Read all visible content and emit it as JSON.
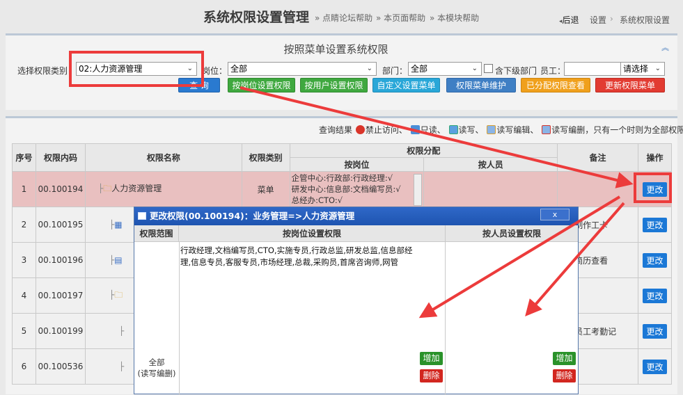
{
  "header": {
    "title": "系统权限设置管理",
    "links": [
      "» 点睛论坛帮助",
      "» 本页面帮助",
      "» 本模块帮助"
    ],
    "breadcrumb": {
      "back": "后退",
      "items": [
        "设置",
        "系统权限设置"
      ]
    }
  },
  "filter": {
    "heading": "按照菜单设置系统权限",
    "category_label": "选择权限类别",
    "category_value": "02:人力资源管理",
    "post_label": "岗位：",
    "post_value": "全部",
    "dept_label": "部门：",
    "dept_value": "全部",
    "subdept_label": "含下级部门",
    "staff_label": "员工：",
    "staff_select": "请选择",
    "buttons": {
      "query": "查 询",
      "by_post": "按岗位设置权限",
      "by_user": "按用户设置权限",
      "custom_menu": "自定义设置菜单",
      "menu_maint": "权限菜单维护",
      "assigned_view": "已分配权限查看",
      "refresh_menu": "更新权限菜单"
    }
  },
  "legend": {
    "query_result": "查询结果",
    "forbid": "禁止访问、",
    "read": "只读、",
    "readwrite": "读写、",
    "readwriteedit": "读写编辑、",
    "readwriteeditdel": "读写编删",
    "note": "，只有一个时则为全部权限"
  },
  "table": {
    "headers": {
      "seq": "序号",
      "code": "权限内码",
      "name": "权限名称",
      "type": "权限类别",
      "assign": "权限分配",
      "by_post": "按岗位",
      "by_user": "按人员",
      "remark": "备注",
      "op": "操作"
    },
    "edit_label": "更改",
    "rows": [
      {
        "seq": "1",
        "code": "00.100194",
        "name": "人力资源管理",
        "type": "菜单",
        "post_lines": [
          "企管中心:行政部:行政经理:√",
          "研发中心:信息部:文档编写员:√",
          "总经办:CTO:√"
        ],
        "remark": ""
      },
      {
        "seq": "2",
        "code": "00.100195",
        "name": "",
        "type": "",
        "post_lines": [],
        "remark": "允许制作工卡"
      },
      {
        "seq": "3",
        "code": "00.100196",
        "name": "",
        "type": "",
        "post_lines": [],
        "remark": "提交简历查看"
      },
      {
        "seq": "4",
        "code": "00.100197",
        "name": "",
        "type": "",
        "post_lines": [],
        "remark": ""
      },
      {
        "seq": "5",
        "code": "00.100199",
        "name": "",
        "type": "",
        "post_lines": [],
        "remark": "所有员工考勤记"
      },
      {
        "seq": "6",
        "code": "00.100536",
        "name": "",
        "type": "",
        "post_lines": [],
        "remark": ""
      }
    ]
  },
  "modal": {
    "title": "更改权限(00.100194)：业务管理=>人力资源管理",
    "close": "x",
    "col_scope": "权限范围",
    "col_post": "按岗位设置权限",
    "col_user": "按人员设置权限",
    "post_text": "行政经理,文档编写员,CTO,实施专员,行政总监,研发总监,信息部经理,信息专员,客服专员,市场经理,总裁,采购员,首席咨询师,网管",
    "scope_value": "全部",
    "scope_note": "(读写编删)",
    "add": "增加",
    "delete": "删除"
  },
  "colors": {
    "accent_red": "#ec3b3b",
    "modal_blue": "#2f68c8",
    "highlight_row": "#e9c0c0"
  }
}
